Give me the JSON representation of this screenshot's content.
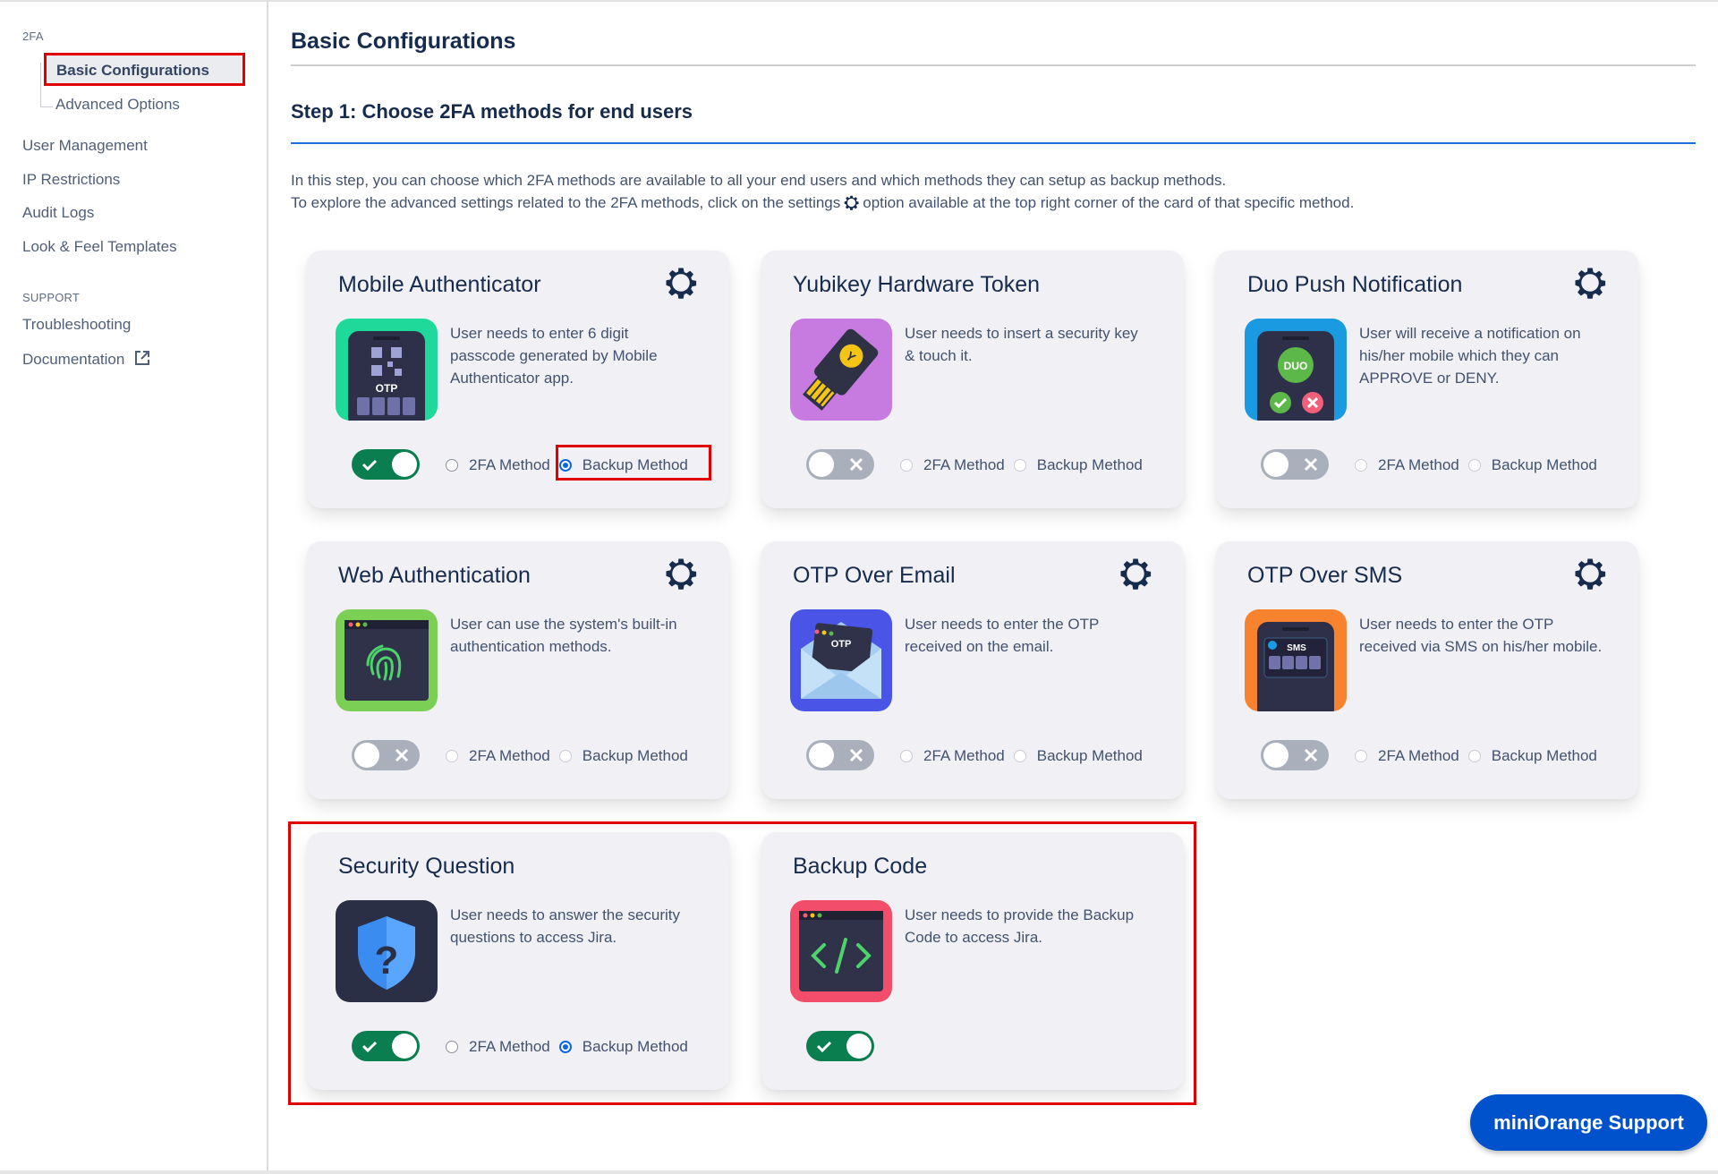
{
  "sidebar": {
    "section_2fa": "2FA",
    "active_item": "Basic Configurations",
    "advanced_options": "Advanced Options",
    "items": [
      "User Management",
      "IP Restrictions",
      "Audit Logs",
      "Look & Feel Templates"
    ],
    "section_support": "SUPPORT",
    "troubleshooting": "Troubleshooting",
    "documentation": "Documentation",
    "documentation_icon": "external-link-icon"
  },
  "main": {
    "title": "Basic Configurations",
    "step_title": "Step 1: Choose 2FA methods for end users",
    "intro_line1": "In this step, you can choose which 2FA methods are available to all your end users and which methods they can setup as backup methods.",
    "intro_line2_before": "To explore the advanced settings related to the 2FA methods, click on the settings",
    "intro_line2_after": "option available at the top right corner of the card of that specific method.",
    "radio_2fa_label": "2FA Method",
    "radio_backup_label": "Backup Method"
  },
  "cards": [
    {
      "title": "Mobile Authenticator",
      "description": "User needs to enter 6 digit passcode generated by Mobile Authenticator app.",
      "icon": "mobile-otp-icon",
      "icon_bg": "#1ed99a",
      "enabled": true,
      "has_settings": true,
      "has_radios": true,
      "selected": "backup"
    },
    {
      "title": "Yubikey Hardware Token",
      "description": "User needs to insert a security key & touch it.",
      "icon": "usb-key-icon",
      "icon_bg": "#c77ae0",
      "enabled": false,
      "has_settings": false,
      "has_radios": true,
      "selected": null
    },
    {
      "title": "Duo Push Notification",
      "description": "User will receive a notification on his/her mobile which they can APPROVE or DENY.",
      "icon": "duo-phone-icon",
      "icon_bg": "#1a9ae0",
      "enabled": false,
      "has_settings": true,
      "has_radios": true,
      "selected": null
    },
    {
      "title": "Web Authentication",
      "description": "User can use the system's built-in authentication methods.",
      "icon": "fingerprint-icon",
      "icon_bg": "#7ccf55",
      "enabled": false,
      "has_settings": true,
      "has_radios": true,
      "selected": null
    },
    {
      "title": "OTP Over Email",
      "description": "User needs to enter the OTP received on the email.",
      "icon": "email-otp-icon",
      "icon_bg": "#4a55e8",
      "enabled": false,
      "has_settings": true,
      "has_radios": true,
      "selected": null
    },
    {
      "title": "OTP Over SMS",
      "description": "User needs to enter the OTP received via SMS on his/her mobile.",
      "icon": "sms-otp-icon",
      "icon_bg": "#f7832f",
      "enabled": false,
      "has_settings": true,
      "has_radios": true,
      "selected": null
    },
    {
      "title": "Security Question",
      "description": "User needs to answer the security questions to access Jira.",
      "icon": "shield-question-icon",
      "icon_bg": "#2b2f45",
      "enabled": true,
      "has_settings": false,
      "has_radios": true,
      "selected": "backup"
    },
    {
      "title": "Backup Code",
      "description": "User needs to provide the Backup Code to access Jira.",
      "icon": "code-window-icon",
      "icon_bg": "#f24d6a",
      "enabled": true,
      "has_settings": false,
      "has_radios": false,
      "selected": null
    }
  ],
  "support_button": "miniOrange Support",
  "colors": {
    "toggle_on": "#0b7e50",
    "toggle_off": "#a9afbb",
    "accent_blue": "#0052cc",
    "highlight_red": "#e00000"
  }
}
